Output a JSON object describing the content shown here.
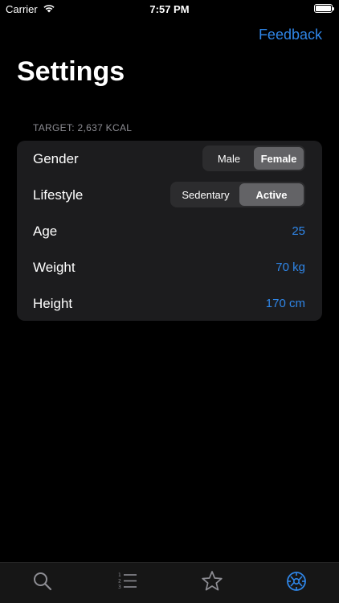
{
  "status_bar": {
    "carrier": "Carrier",
    "time": "7:57 PM"
  },
  "nav": {
    "feedback_label": "Feedback",
    "title": "Settings"
  },
  "section": {
    "header": "TARGET: 2,637 KCAL"
  },
  "rows": {
    "gender": {
      "label": "Gender",
      "options": [
        "Male",
        "Female"
      ],
      "selected": "Female"
    },
    "lifestyle": {
      "label": "Lifestyle",
      "options": [
        "Sedentary",
        "Active"
      ],
      "selected": "Active"
    },
    "age": {
      "label": "Age",
      "value": "25"
    },
    "weight": {
      "label": "Weight",
      "value": "70 kg"
    },
    "height": {
      "label": "Height",
      "value": "170 cm"
    }
  },
  "tab_bar": {
    "tabs": [
      {
        "icon": "search-icon",
        "active": false
      },
      {
        "icon": "numbered-list-icon",
        "active": false
      },
      {
        "icon": "star-icon",
        "active": false
      },
      {
        "icon": "gear-icon",
        "active": true
      }
    ]
  },
  "colors": {
    "accent": "#2f86e8",
    "background": "#000000",
    "card": "#1c1c1e",
    "inactive_icon": "#8d8d93"
  }
}
